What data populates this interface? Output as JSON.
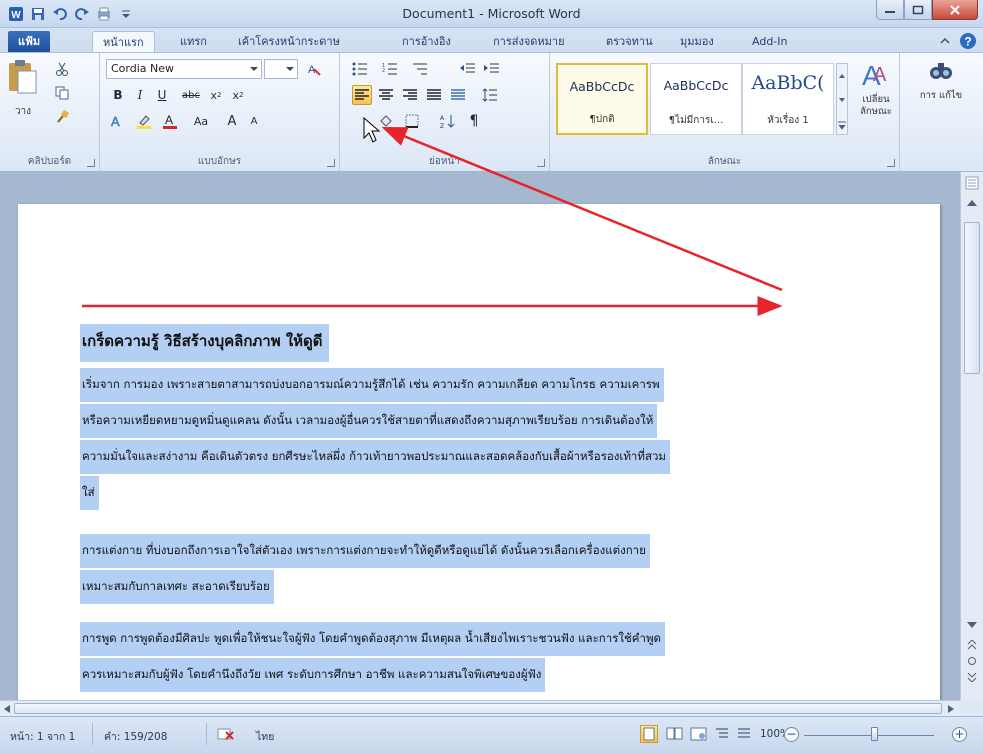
{
  "window": {
    "title": "Document1 - Microsoft Word"
  },
  "tabs": [
    {
      "label": "แฟ้ม"
    },
    {
      "label": "หน้าแรก"
    },
    {
      "label": "แทรก"
    },
    {
      "label": "เค้าโครงหน้ากระดาษ"
    },
    {
      "label": "การอ้างอิง"
    },
    {
      "label": "การส่งจดหมาย"
    },
    {
      "label": "ตรวจทาน"
    },
    {
      "label": "มุมมอง"
    },
    {
      "label": "Add-In"
    }
  ],
  "ribbon": {
    "clipboard": {
      "label": "คลิปบอร์ด",
      "paste_label": "วาง"
    },
    "font": {
      "label": "แบบอักษร",
      "font_name": "Cordia New",
      "font_size": ""
    },
    "paragraph": {
      "label": "ย่อหน้า",
      "selected_button": "align-left"
    },
    "styles": {
      "label": "ลักษณะ",
      "items": [
        {
          "sample": "AaBbCcDc",
          "name": "¶ปกติ"
        },
        {
          "sample": "AaBbCcDc",
          "name": "¶ไม่มีการเ..."
        },
        {
          "sample": "AaBbC(",
          "name": "หัวเรื่อง 1"
        }
      ],
      "change_styles_label": "เปลี่ยน ลักษณะ",
      "editing_label": "การ แก้ไข"
    }
  },
  "document": {
    "title": "เกร็ดความรู้ วิธีสร้างบุคลิกภาพ ให้ดูดี",
    "lines": [
      "เริ่มจาก การมอง เพราะสายตาสามารถบ่งบอกอารมณ์ความรู้สึกได้ เช่น ความรัก ความเกลียด ความโกรธ ความเคารพ",
      "หรือความเหยียดหยามดูหมิ่นดูแคลน ดังนั้น เวลามองผู้อื่นควรใช้สายตาที่แสดงถึงความสุภาพเรียบร้อย การเดินต้องให้",
      "ความมั่นใจและสง่างาม คือเดินตัวตรง ยกศีรษะไหล่ผึ่ง ก้าวเท้ายาวพอประมาณและสอดคล้องกับเสื้อผ้าหรือรองเท้าที่สวม",
      "ใส่",
      "การแต่งกาย ที่บ่งบอกถึงการเอาใจใส่ตัวเอง เพราะการแต่งกายจะทำให้ดูดีหรือดูแย่ได้ ดังนั้นควรเลือกเครื่องแต่งกาย",
      "เหมาะสมกับกาลเทศะ สะอาดเรียบร้อย",
      "การพูด การพูดต้องมีศิลปะ พูดเพื่อให้ชนะใจผู้ฟัง โดยคำพูดต้องสุภาพ มีเหตุผล น้ำเสียงไพเราะชวนฟัง และการใช้คำพูด",
      "ควรเหมาะสมกับผู้ฟัง โดยคำนึงถึงวัย เพศ ระดับการศึกษา อาชีพ และความสนใจพิเศษของผู้ฟัง"
    ]
  },
  "statusbar": {
    "page": "หน้า: 1 จาก 1",
    "words": "คำ: 159/208",
    "language": "ไทย",
    "zoom": "100%",
    "zoom_level": 1.0
  },
  "colors": {
    "selection": "#b3cff3",
    "annotation": "#e8232a",
    "file_tab": "#2a5db0"
  }
}
